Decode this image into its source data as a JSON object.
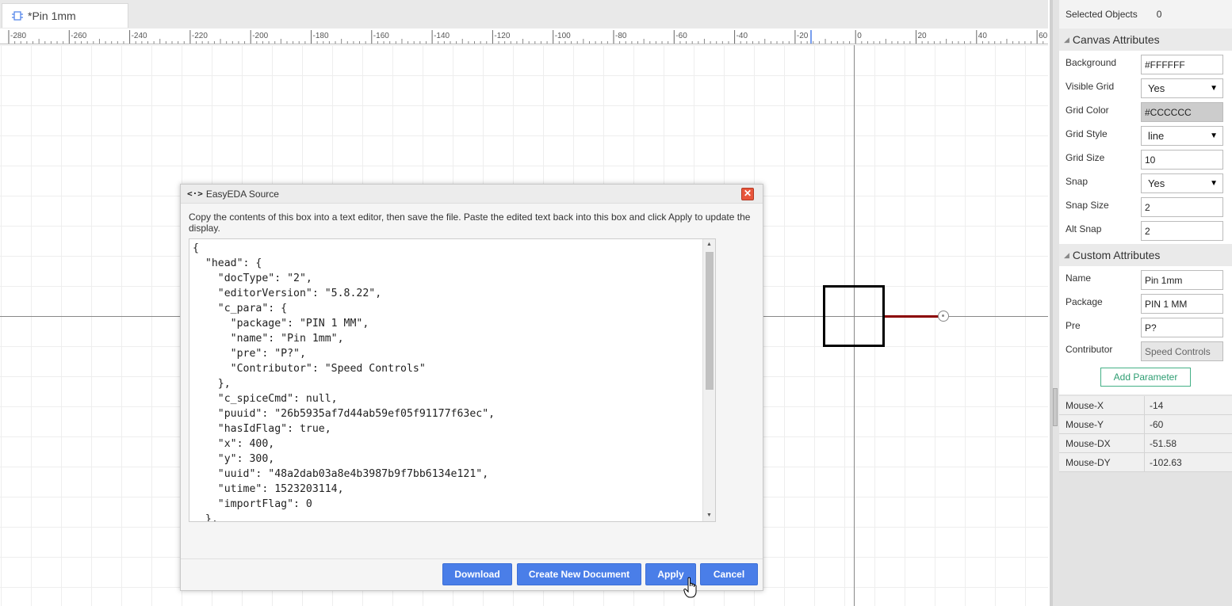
{
  "tab": {
    "title": "*Pin 1mm",
    "icon": "schematic-symbol-icon"
  },
  "ruler": {
    "labels": [
      "-280",
      "-260",
      "-240",
      "-220",
      "-200",
      "-180",
      "-160",
      "-140",
      "-120",
      "-100",
      "-80",
      "-60",
      "-40",
      "-20",
      "0",
      "20",
      "40",
      "60"
    ]
  },
  "dialog": {
    "title": "EasyEDA Source",
    "title_icon": "<·>",
    "close_symbol": "✕",
    "description": "Copy the contents of this box into a text editor, then save the file. Paste the edited text back into this box and click Apply to update the display.",
    "source_text": "{\n  \"head\": {\n    \"docType\": \"2\",\n    \"editorVersion\": \"5.8.22\",\n    \"c_para\": {\n      \"package\": \"PIN 1 MM\",\n      \"name\": \"Pin 1mm\",\n      \"pre\": \"P?\",\n      \"Contributor\": \"Speed Controls\"\n    },\n    \"c_spiceCmd\": null,\n    \"puuid\": \"26b5935af7d44ab59ef05f91177f63ec\",\n    \"hasIdFlag\": true,\n    \"x\": 400,\n    \"y\": 300,\n    \"uuid\": \"48a2dab03a8e4b3987b9f7bb6134e121\",\n    \"utime\": 1523203114,\n    \"importFlag\": 0\n  },",
    "buttons": {
      "download": "Download",
      "create_new": "Create New Document",
      "apply": "Apply",
      "cancel": "Cancel"
    },
    "scroll_up": "▲",
    "scroll_down": "▼"
  },
  "panel": {
    "selected_objects_label": "Selected Objects",
    "selected_objects_value": "0",
    "canvas_section": "Canvas Attributes",
    "canvas": {
      "background": {
        "label": "Background",
        "value": "#FFFFFF"
      },
      "visible_grid": {
        "label": "Visible Grid",
        "value": "Yes"
      },
      "grid_color": {
        "label": "Grid Color",
        "value": "#CCCCCC"
      },
      "grid_style": {
        "label": "Grid Style",
        "value": "line"
      },
      "grid_size": {
        "label": "Grid Size",
        "value": "10"
      },
      "snap": {
        "label": "Snap",
        "value": "Yes"
      },
      "snap_size": {
        "label": "Snap Size",
        "value": "2"
      },
      "alt_snap": {
        "label": "Alt Snap",
        "value": "2"
      }
    },
    "custom_section": "Custom Attributes",
    "custom": {
      "name": {
        "label": "Name",
        "value": "Pin 1mm"
      },
      "package": {
        "label": "Package",
        "value": "PIN 1 MM"
      },
      "pre": {
        "label": "Pre",
        "value": "P?"
      },
      "contributor": {
        "label": "Contributor",
        "value": "Speed Controls"
      }
    },
    "add_parameter": "Add Parameter",
    "section_arrow": "◢",
    "dropdown_arrow": "▼",
    "mouse": [
      {
        "label": "Mouse-X",
        "value": "-14"
      },
      {
        "label": "Mouse-Y",
        "value": "-60"
      },
      {
        "label": "Mouse-DX",
        "value": "-51.58"
      },
      {
        "label": "Mouse-DY",
        "value": "-102.63"
      }
    ]
  },
  "colors": {
    "accent": "#4a7ee8",
    "pin_line": "#8b0000",
    "add_param": "#2e9d72",
    "close": "#e8553b"
  }
}
